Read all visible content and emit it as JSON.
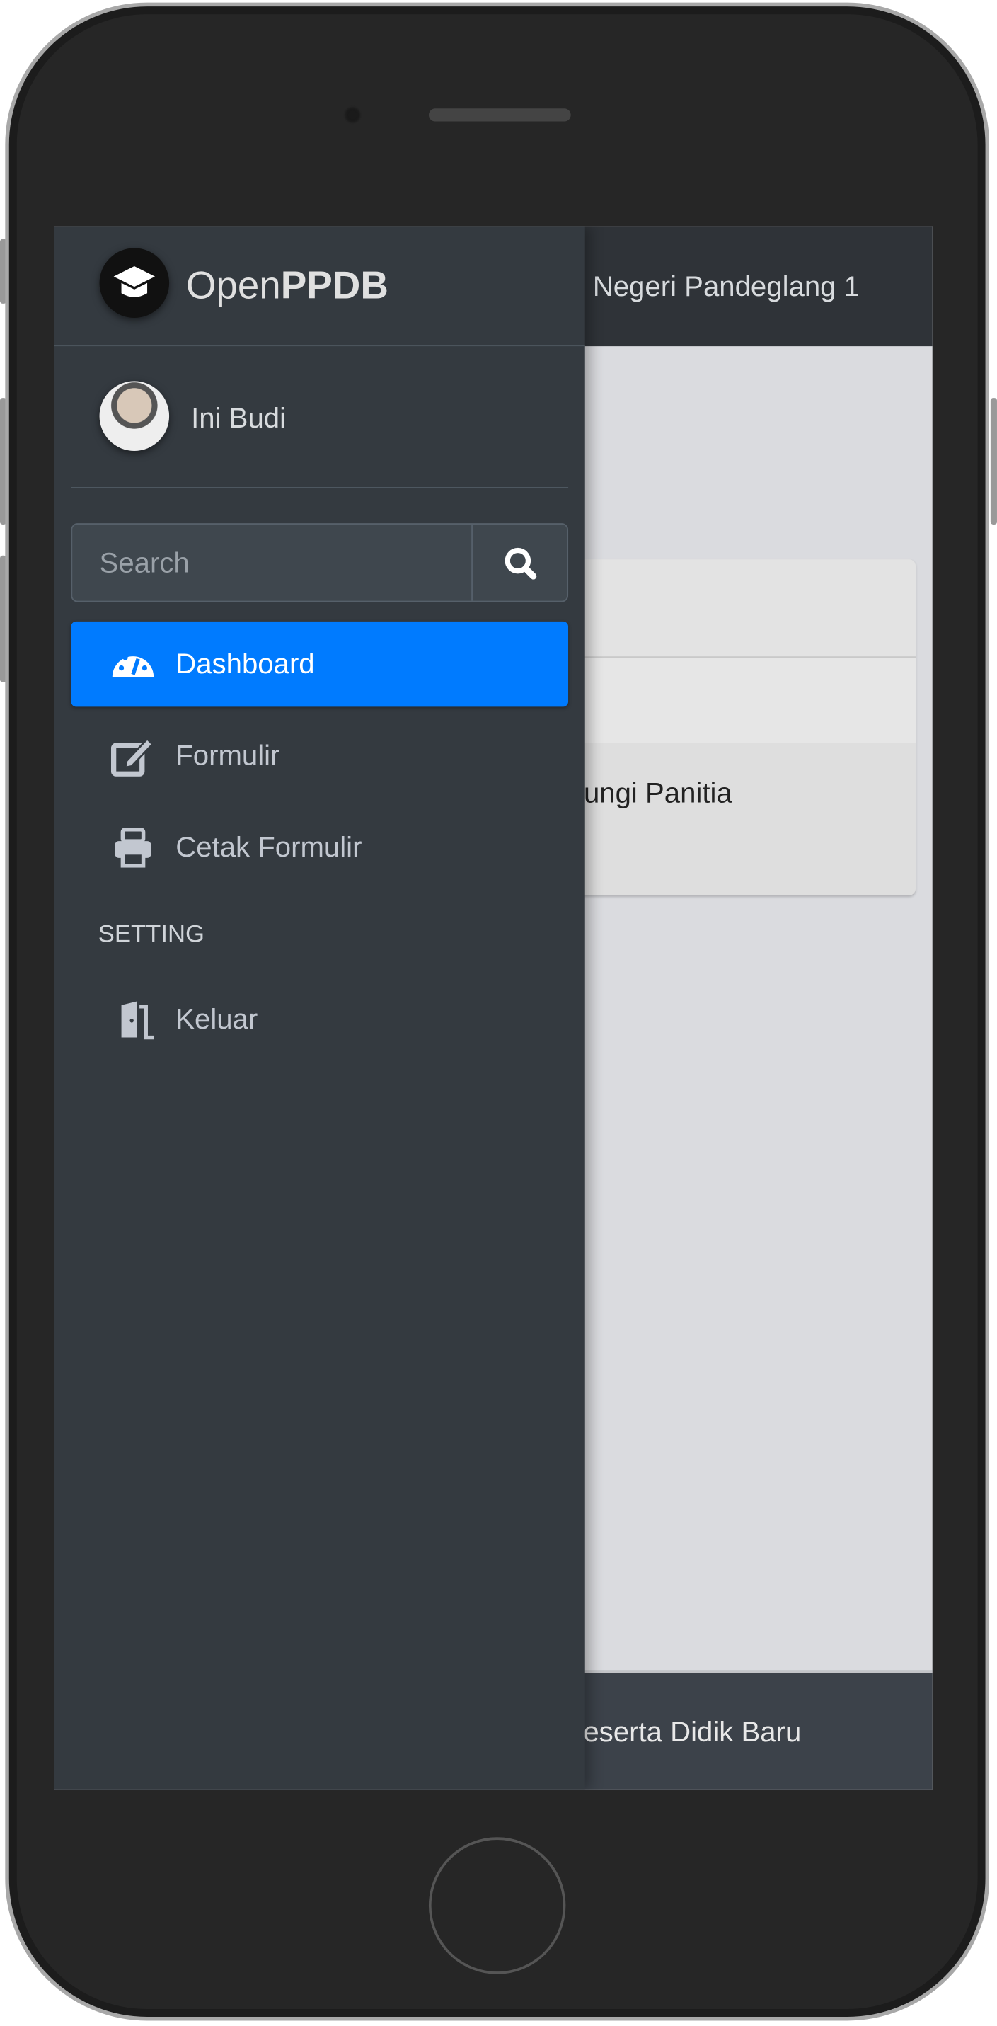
{
  "app": {
    "brand_light": "Open",
    "brand_bold": "PPDB"
  },
  "topbar": {
    "title": "Negeri Pandeglang 1"
  },
  "content": {
    "card_text": "ungi Panitia"
  },
  "footer": {
    "text": "Peserta Didik Baru"
  },
  "sidebar": {
    "user_name": "Ini Budi",
    "search": {
      "placeholder": "Search",
      "value": ""
    },
    "items": [
      {
        "label": "Dashboard",
        "icon": "tachometer-icon",
        "active": true
      },
      {
        "label": "Formulir",
        "icon": "edit-icon",
        "active": false
      },
      {
        "label": "Cetak Formulir",
        "icon": "print-icon",
        "active": false
      }
    ],
    "section_header": "SETTING",
    "setting_items": [
      {
        "label": "Keluar",
        "icon": "door-open-icon"
      }
    ]
  },
  "colors": {
    "accent": "#007bff",
    "sidebar_bg": "#343a40",
    "topbar_bg": "#2f3338"
  }
}
